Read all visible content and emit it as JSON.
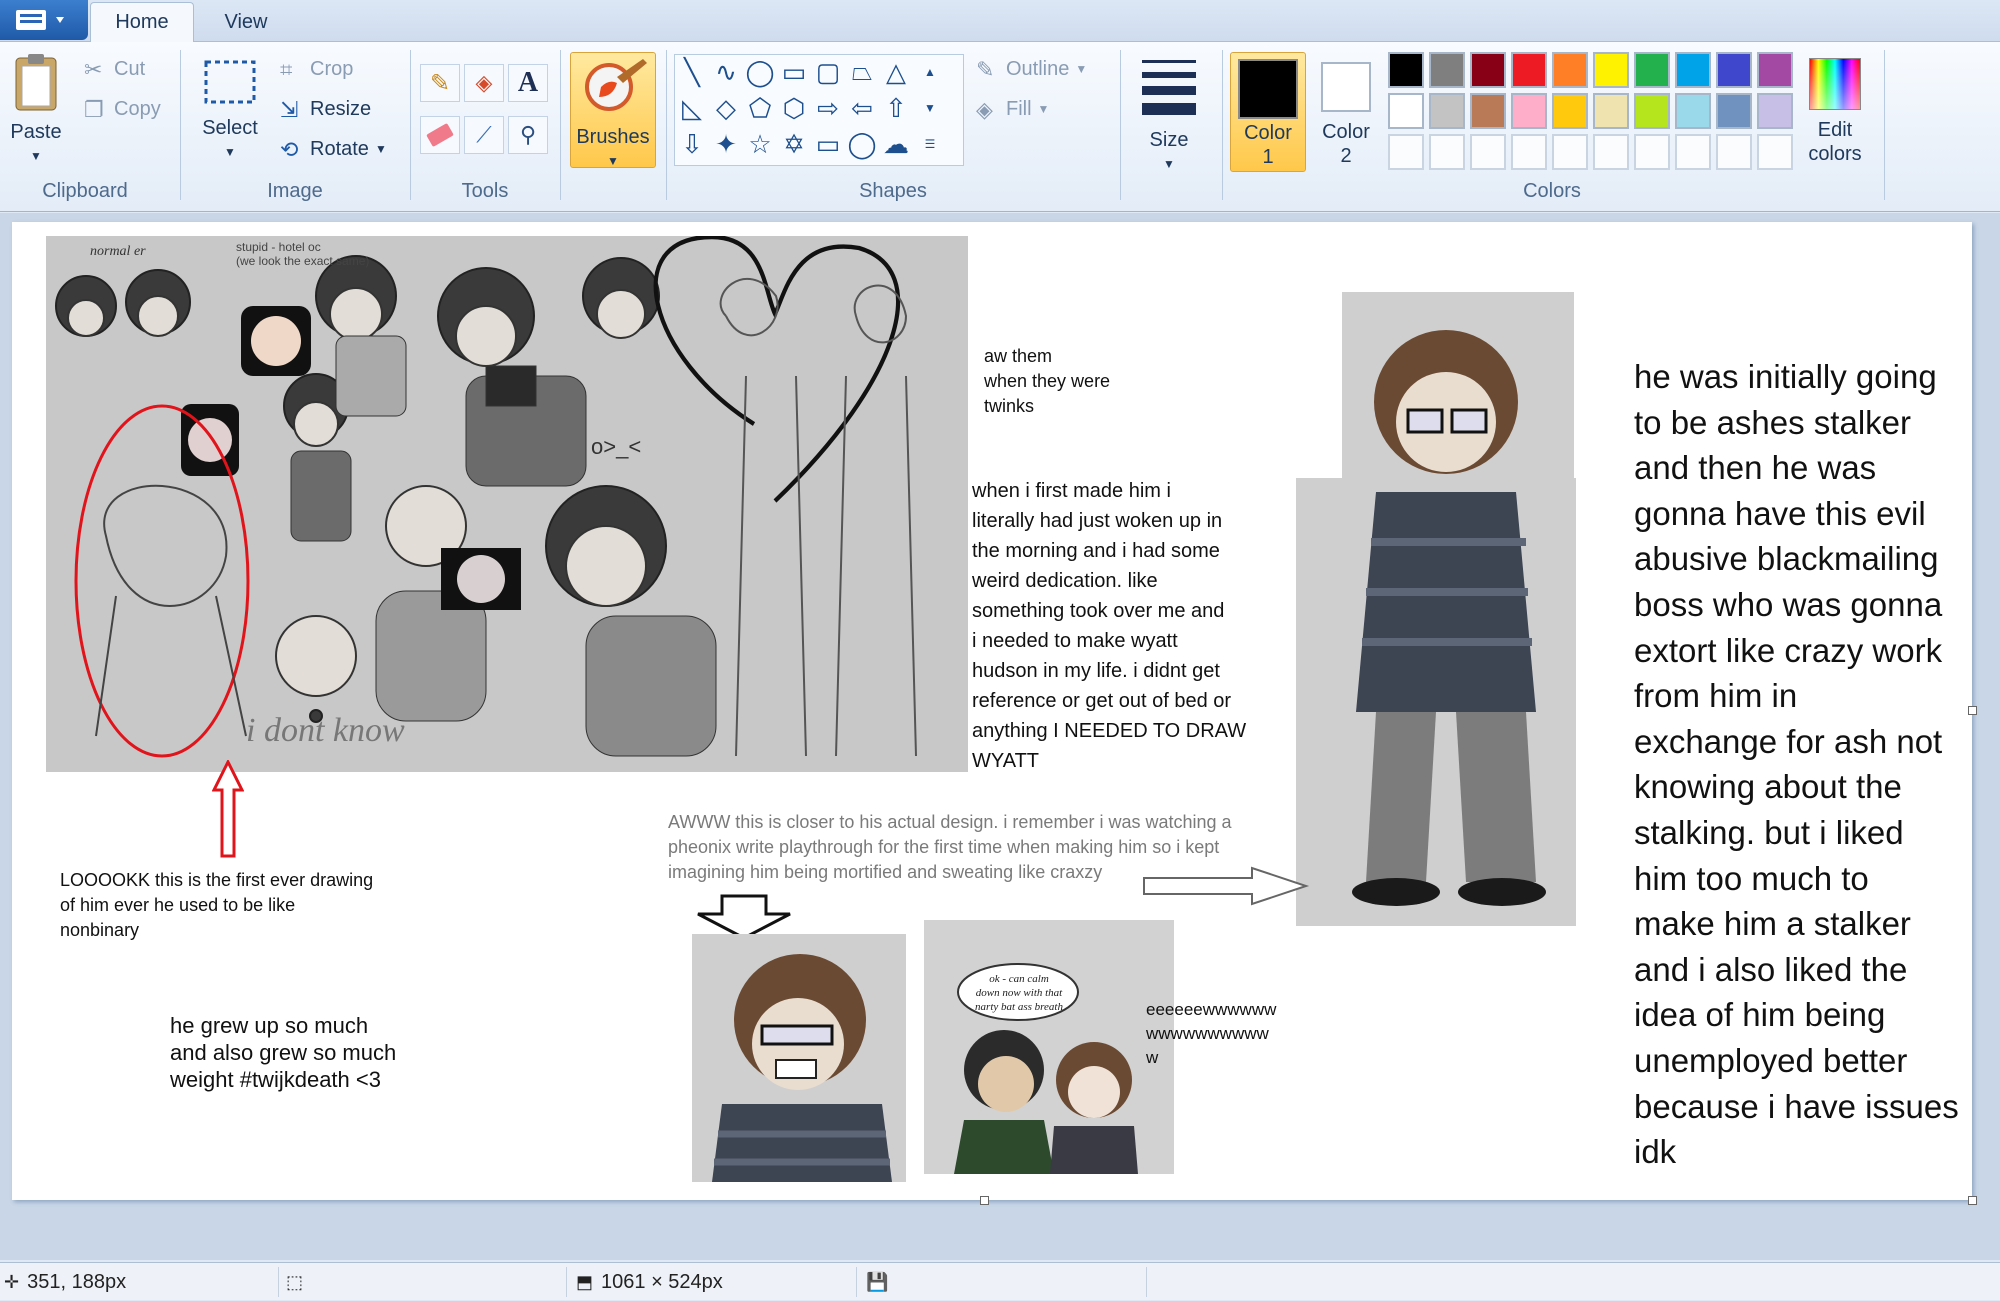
{
  "tabs": {
    "home": "Home",
    "view": "View"
  },
  "clipboard": {
    "paste": "Paste",
    "cut": "Cut",
    "copy": "Copy",
    "group": "Clipboard"
  },
  "image": {
    "select": "Select",
    "crop": "Crop",
    "resize": "Resize",
    "rotate": "Rotate",
    "group": "Image"
  },
  "tools": {
    "group": "Tools",
    "text_tool": "A"
  },
  "brushes": {
    "label": "Brushes"
  },
  "shapes": {
    "group": "Shapes",
    "outline": "Outline",
    "fill": "Fill"
  },
  "size": {
    "label": "Size"
  },
  "colors": {
    "group": "Colors",
    "color1_label": "Color\n1",
    "color2_label": "Color\n2",
    "edit_label": "Edit\ncolors",
    "color1": "#000000",
    "color2": "#ffffff",
    "row1": [
      "#000000",
      "#7f7f7f",
      "#880015",
      "#ed1c24",
      "#ff7f27",
      "#fff200",
      "#22b14c",
      "#00a2e8",
      "#3f48cc",
      "#a349a4"
    ],
    "row2": [
      "#ffffff",
      "#c3c3c3",
      "#b97a57",
      "#ffaec9",
      "#ffc90e",
      "#efe4b0",
      "#b5e61d",
      "#99d9ea",
      "#7092be",
      "#c8bfe7"
    ]
  },
  "canvas": {
    "sketch_labels": {
      "normal": "normal er",
      "stupid": "stupid - hotel oc\n(we look the exact same)",
      "dont_know": "i dont know",
      "face_emote": "o>_<"
    },
    "notes": {
      "aw_them": "aw them\nwhen they were\ntwinks",
      "first_made": "when  i first made him i\nliterally had just woken up in\nthe morning and i had some\nweird dedication. like\nsomething took over me and\ni needed to make wyatt\nhudson in my life. i didnt get\nreference or get out of bed or\nanything I NEEDED TO DRAW\nWYATT",
      "right_text": "he was initially going\nto be ashes stalker\nand then he was\ngonna have this evil\nabusive blackmailing\nboss who was gonna\nextort like crazy work\nfrom him in\nexchange for ash not\nknowing about the\nstalking. but i liked\nhim too much to\nmake him a stalker\nand i also liked the\nidea of him being\nunemployed better\nbecause i have issues\nidk",
      "awww": "AWWW this is closer to his actual design. i remember i was watching a\npheonix write playthrough for the first time when making him so i kept\nimagining him being mortified and sweating like craxzy",
      "loook": "LOOOOKK this is the first ever drawing\nof him ever he used to be like\nnonbinary",
      "grew_up": "he grew up so much\nand also grew so much\nweight #twijkdeath <3",
      "eeee": "eeeeeewwwwww\nwwwwwwwwww\nw",
      "speech": "ok - can calm\ndown now with that\nnarty bat ass breath"
    }
  },
  "status": {
    "cursor": "351, 188px",
    "selection": "",
    "size": "1061 × 524px"
  }
}
